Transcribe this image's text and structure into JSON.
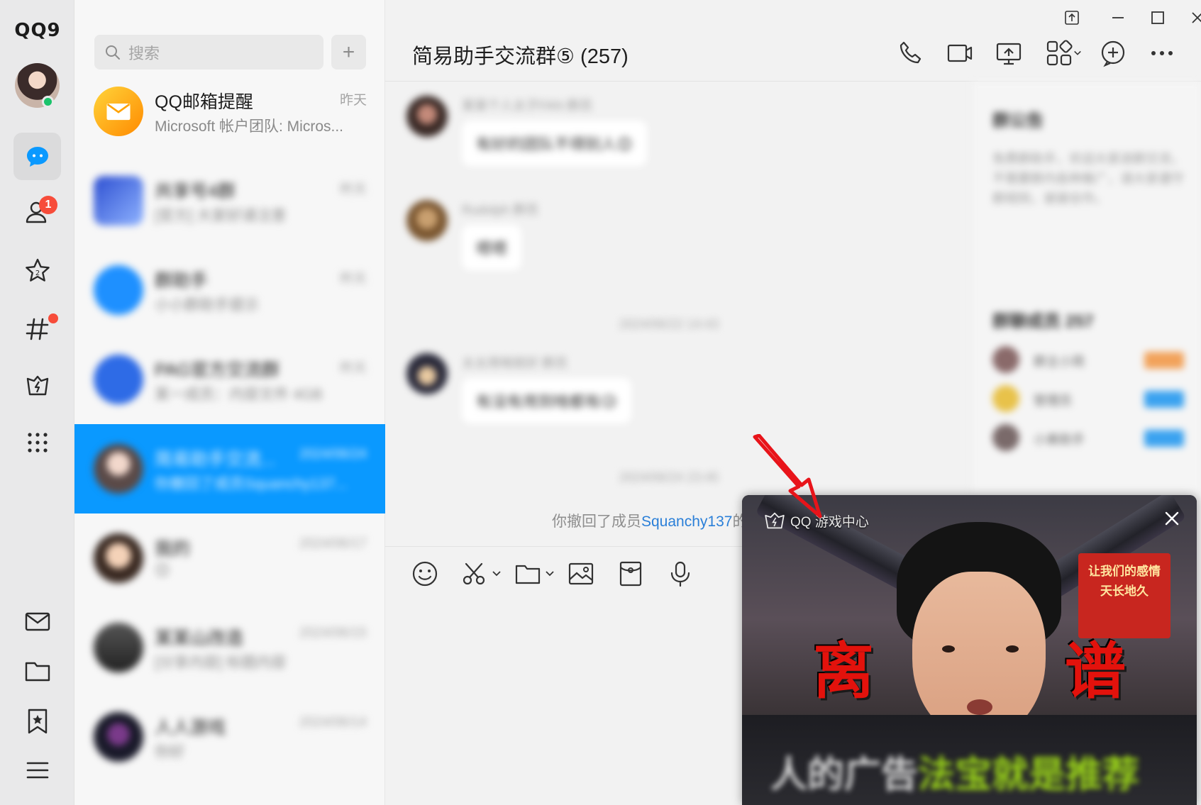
{
  "app": {
    "logo": "QQ9",
    "rail_badge_contacts": "1"
  },
  "search": {
    "placeholder": "搜索",
    "add_label": "+"
  },
  "conversations": [
    {
      "title": "QQ邮箱提醒",
      "preview": "Microsoft 帐户团队: Micros...",
      "time": "昨天",
      "blurred": false,
      "selected": false
    },
    {
      "title": "共享号4群",
      "preview": "[官方] 大家好请注意",
      "time": "昨天",
      "blurred": true,
      "selected": false
    },
    {
      "title": "群助手",
      "preview": "小小群助手提示",
      "time": "昨天",
      "blurred": true,
      "selected": false
    },
    {
      "title": "PAG官方交流群",
      "preview": "某一成员：内容文件 4GB",
      "time": "昨天",
      "blurred": true,
      "selected": false
    },
    {
      "title": "简易助手交流...",
      "preview": "你撤回了成员Squanchy137...",
      "time": "2024/06/24",
      "blurred": true,
      "selected": true
    },
    {
      "title": "我的",
      "preview": "😊",
      "time": "2024/06/17",
      "blurred": true,
      "selected": false
    },
    {
      "title": "某某山改造",
      "preview": "[分享内容] 标题内容",
      "time": "2024/06/15",
      "blurred": true,
      "selected": false
    },
    {
      "title": "人人游戏",
      "preview": "你好",
      "time": "2024/06/14",
      "blurred": true,
      "selected": false
    }
  ],
  "chat": {
    "title": "简易助手交流群⑤ (257)",
    "messages": [
      {
        "name": "某某个人太子FAN 群员",
        "text": "有好的团队不得别人😊"
      },
      {
        "name": "Rudolph 群员",
        "text": "嗯嗯"
      },
      {
        "name": "太太用啥就好 群员",
        "text": "有没有用到啥都有😥"
      }
    ],
    "timestamps": [
      "2024/06/22 14:43",
      "2024/06/24 23:45"
    ],
    "recall_prefix": "你撤回了成员",
    "recall_member": "Squanchy137",
    "recall_suffix": "的"
  },
  "side_panel": {
    "notice_title": "群公告",
    "notice_text": "免费群助手，欢迎大家进群交流，不需要群内各种推广，请大家遵守群规则，谢谢合作。",
    "members_title": "群聊成员 257",
    "members": [
      {
        "name": "群主小简",
        "tag_color": "#f2a25a"
      },
      {
        "name": "管理员",
        "tag_color": "#3aa2f0"
      },
      {
        "name": "小美助手",
        "tag_color": "#3aa2f0"
      }
    ]
  },
  "popup": {
    "brand": "QQ 游戏中心",
    "char_left": "离",
    "char_right": "谱",
    "poster_text": "让我们的感情\n天长地久",
    "strip_text_a": "人的广告",
    "strip_text_b": "法宝",
    "strip_text_c": "就是推荐"
  },
  "colors": {
    "accent": "#0a99ff",
    "badge": "#f74c3a",
    "online": "#1bc36b",
    "arrow": "#e8141a"
  }
}
